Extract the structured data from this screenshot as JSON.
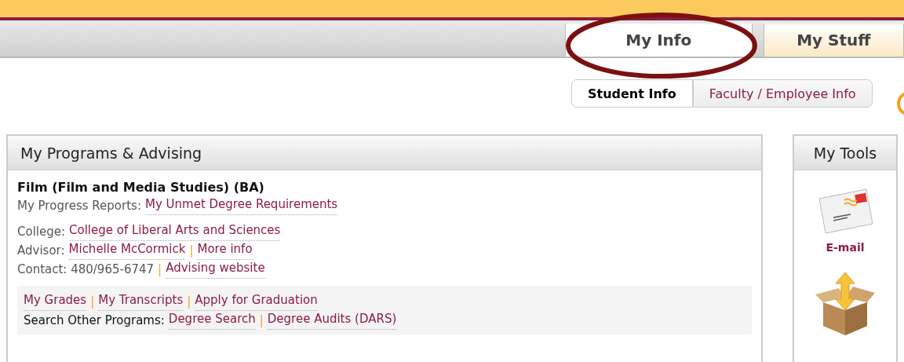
{
  "tabs": [
    {
      "label": "My Info",
      "selected": true
    },
    {
      "label": "My Stuff",
      "selected": false
    }
  ],
  "subtabs": [
    {
      "label": "Student Info",
      "selected": true
    },
    {
      "label": "Faculty / Employee Info",
      "selected": false
    }
  ],
  "programs": {
    "title": "My Programs & Advising",
    "program": "Film (Film and Media Studies) (BA)",
    "groups": [
      {
        "kind": "plain",
        "lines": [
          [
            {
              "kind": "text",
              "text": "My Progress Reports:"
            },
            {
              "kind": "link",
              "text": "My Unmet Degree Requirements"
            }
          ]
        ]
      },
      {
        "kind": "plain",
        "lines": [
          [
            {
              "kind": "text",
              "text": "College:"
            },
            {
              "kind": "link",
              "text": "College of Liberal Arts and Sciences"
            }
          ],
          [
            {
              "kind": "text",
              "text": "Advisor:"
            },
            {
              "kind": "link",
              "text": "Michelle McCormick"
            },
            {
              "kind": "sep",
              "text": "|"
            },
            {
              "kind": "link",
              "text": "More info"
            }
          ],
          [
            {
              "kind": "text",
              "text": "Contact: 480/965-6747"
            },
            {
              "kind": "sep",
              "text": "|"
            },
            {
              "kind": "link",
              "text": "Advising website"
            }
          ]
        ]
      },
      {
        "kind": "shaded",
        "lines": [
          [
            {
              "kind": "link",
              "text": "My Grades"
            },
            {
              "kind": "sep",
              "text": "|"
            },
            {
              "kind": "link",
              "text": "My Transcripts"
            },
            {
              "kind": "sep",
              "text": "|"
            },
            {
              "kind": "link",
              "text": "Apply for Graduation"
            }
          ],
          [
            {
              "kind": "label",
              "text": "Search Other Programs:"
            },
            {
              "kind": "link",
              "text": "Degree Search"
            },
            {
              "kind": "sep",
              "text": "|"
            },
            {
              "kind": "link",
              "text": "Degree Audits (DARS)"
            }
          ]
        ]
      }
    ]
  },
  "tools": {
    "title": "My Tools",
    "items": [
      {
        "kind": "email",
        "label": "E-mail"
      },
      {
        "kind": "files"
      }
    ]
  }
}
